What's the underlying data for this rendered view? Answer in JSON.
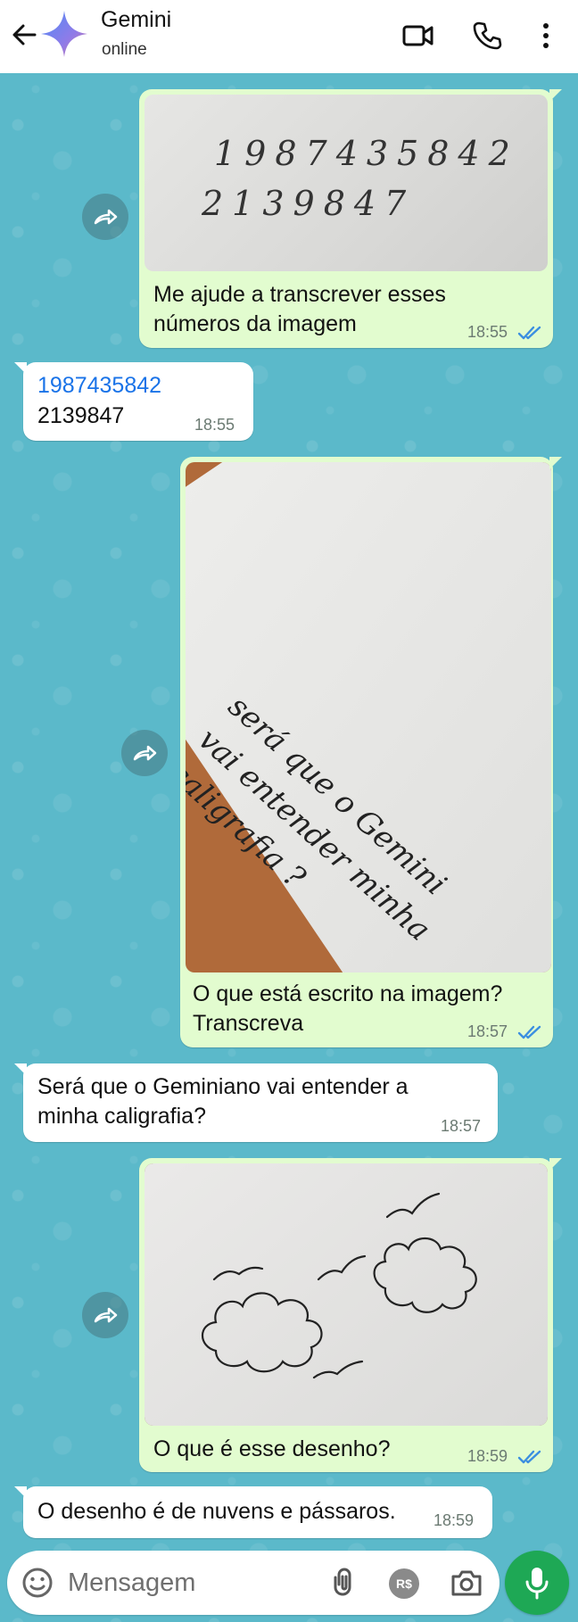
{
  "header": {
    "title": "Gemini",
    "status": "online",
    "icons": [
      "back-arrow-icon",
      "gemini-avatar",
      "video-call-icon",
      "phone-call-icon",
      "more-options-icon"
    ]
  },
  "messages": [
    {
      "direction": "outgoing",
      "image": {
        "description_text_line1": "1987435842",
        "description_text_line2": "2139847"
      },
      "text": "Me ajude a transcrever esses números da imagem",
      "text_line1": "Me ajude a transcrever esses",
      "text_line2": "números da imagem",
      "time": "18:55",
      "status": "read"
    },
    {
      "direction": "incoming",
      "text_line1": "1987435842",
      "text_line2": "2139847",
      "time": "18:55"
    },
    {
      "direction": "outgoing",
      "image": {
        "handwriting_line1": "será que o Gemini",
        "handwriting_line2": "vai entender minha",
        "handwriting_line3": "caligrafia ?"
      },
      "text_line1": "O que está escrito na imagem?",
      "text_line2": "Transcreva",
      "time": "18:57",
      "status": "read"
    },
    {
      "direction": "incoming",
      "text_line1": "Será que o Geminiano vai entender a",
      "text_line2": "minha caligrafia?",
      "time": "18:57"
    },
    {
      "direction": "outgoing",
      "image": {
        "subject": "drawing"
      },
      "text_line1": "O que é esse desenho?",
      "time": "18:59",
      "status": "read"
    },
    {
      "direction": "incoming",
      "text_line1": "O desenho é de nuvens e pássaros.",
      "time": "18:59"
    }
  ],
  "composer": {
    "placeholder": "Mensagem",
    "pay_label": "R$"
  },
  "colors": {
    "outgoing_bubble": "#e2fccf",
    "incoming_bubble": "#ffffff",
    "read_check": "#3b8fe0",
    "mic_button": "#1ea855",
    "link": "#1a73e8"
  }
}
